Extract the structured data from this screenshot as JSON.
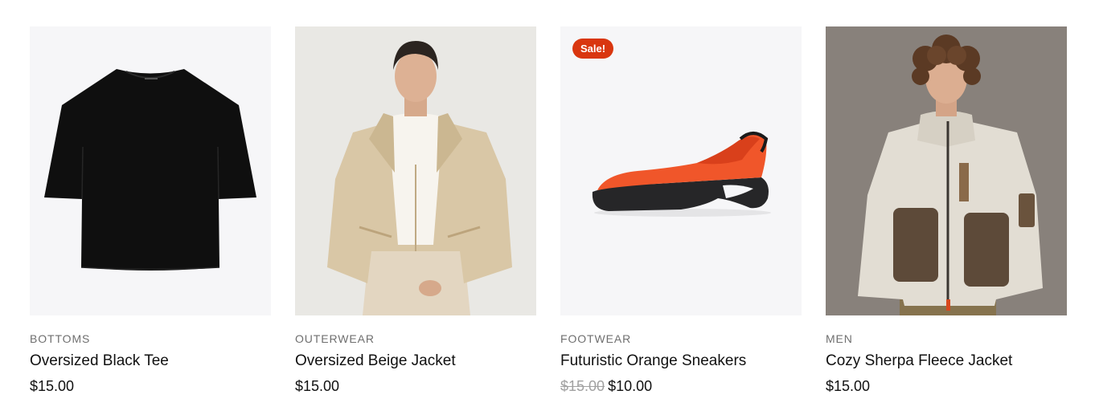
{
  "products": [
    {
      "category": "BOTTOMS",
      "title": "Oversized Black Tee",
      "price": "$15.00",
      "image": "black-tshirt-image"
    },
    {
      "category": "OUTERWEAR",
      "title": "Oversized Beige Jacket",
      "price": "$15.00",
      "image": "man-beige-jacket-image"
    },
    {
      "category": "FOOTWEAR",
      "title": "Futuristic Orange Sneakers",
      "badge": "Sale!",
      "old_price": "$15.00",
      "price": "$10.00",
      "image": "orange-sneaker-image"
    },
    {
      "category": "MEN",
      "title": "Cozy Sherpa Fleece Jacket",
      "price": "$15.00",
      "image": "man-sherpa-fleece-image"
    }
  ],
  "colors": {
    "badge": "#d9360f",
    "image_background": "#f6f6f8",
    "muted_text": "#6f6f6f",
    "old_price": "#a1a1a1"
  }
}
